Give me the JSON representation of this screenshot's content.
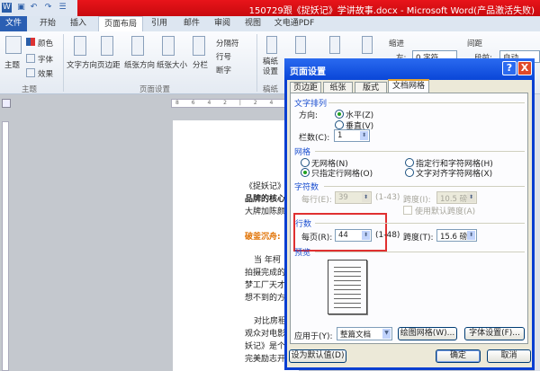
{
  "window": {
    "title": "150729跟《捉妖记》学讲故事.docx - Microsoft Word(产品激活失败)"
  },
  "quick_access": {
    "word_icon": "W",
    "save_icon": "save-icon",
    "undo_icon": "↶",
    "redo_icon": "↷",
    "list_icon": "☰"
  },
  "tabs": [
    {
      "label": "文件"
    },
    {
      "label": "开始"
    },
    {
      "label": "插入"
    },
    {
      "label": "页面布局"
    },
    {
      "label": "引用"
    },
    {
      "label": "邮件"
    },
    {
      "label": "审阅"
    },
    {
      "label": "视图"
    },
    {
      "label": "文电通PDF"
    }
  ],
  "ribbon": {
    "theme": {
      "main": "主题",
      "colors": "颜色",
      "fonts": "字体",
      "effects": "效果",
      "group": "主题"
    },
    "page_setup": {
      "text_direction": "文字方向",
      "margins": "页边距",
      "orientation": "纸张方向",
      "size": "纸张大小",
      "columns": "分栏",
      "breaks": "分隔符",
      "line_numbers": "行号",
      "hyphenation": "断字",
      "group": "页面设置"
    },
    "manuscript": {
      "label": "稿纸设置",
      "group": "稿纸"
    },
    "indent": {
      "title": "缩进",
      "left_label": "左:",
      "left_value": "0 字符"
    },
    "spacing": {
      "title": "间距",
      "before_label": "段前:",
      "before_value": "自动"
    }
  },
  "ruler": {
    "ticks": "8 6 4 2 | 2 4"
  },
  "document": {
    "lines": [
      "《捉妖记》",
      "品牌的核心",
      "大牌加陈颜",
      "破釜沉舟:",
      "当  年柯",
      "拍摄完成的",
      "梦工厂天才",
      "想不到的方",
      "对比房租",
      "观众对电影",
      "妖记》是个",
      "完美励志开"
    ]
  },
  "dialog": {
    "title": "页面设置",
    "help": "?",
    "close": "X",
    "tabs": [
      {
        "label": "页边距"
      },
      {
        "label": "纸张"
      },
      {
        "label": "版式"
      },
      {
        "label": "文档网格"
      }
    ],
    "text_flow": {
      "title": "文字排列",
      "direction_label": "方向:",
      "horizontal": "水平(Z)",
      "vertical": "垂直(V)",
      "columns_label": "栏数(C):",
      "columns_value": "1"
    },
    "grid": {
      "title": "网格",
      "none": "无网格(N)",
      "lines_chars": "指定行和字符网格(H)",
      "lines_only": "只指定行网格(O)",
      "snap_chars": "文字对齐字符网格(X)"
    },
    "chars": {
      "title": "字符数",
      "per_line_label": "每行(E):",
      "per_line_value": "39",
      "per_line_range": "(1-43)",
      "pitch_label": "跨度(I):",
      "pitch_value": "10.5 磅",
      "default_pitch": "使用默认跨度(A)"
    },
    "lines": {
      "title": "行数",
      "per_page_label": "每页(R):",
      "per_page_value": "44",
      "per_page_range": "(1-48)",
      "pitch_label": "跨度(T):",
      "pitch_value": "15.6 磅"
    },
    "preview": {
      "title": "预览"
    },
    "apply_label": "应用于(Y):",
    "apply_value": "整篇文档",
    "drawing_grid": "绘图网格(W)...",
    "font_settings": "字体设置(F)...",
    "set_default": "设为默认值(D)",
    "ok": "确定",
    "cancel": "取消"
  },
  "colors": {
    "title_red": "#d5101a",
    "dialog_blue": "#0a46d8",
    "highlight": "#e03030",
    "orange_text": "#e07000"
  }
}
